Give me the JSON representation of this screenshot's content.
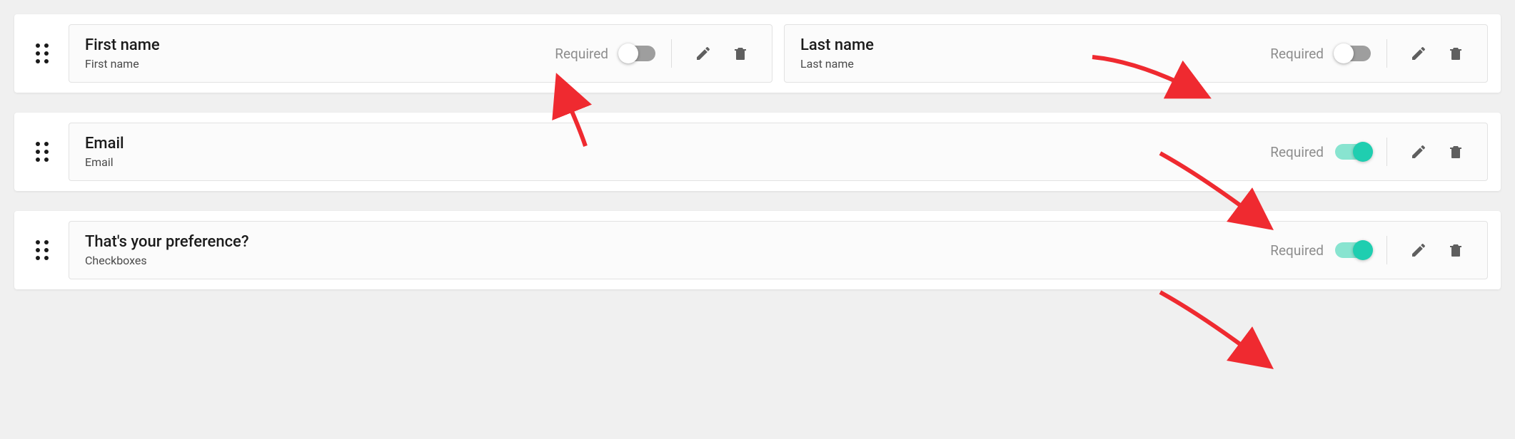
{
  "rows": [
    {
      "fields": [
        {
          "title": "First name",
          "subtitle": "First name",
          "required_label": "Required",
          "required_on": false
        },
        {
          "title": "Last name",
          "subtitle": "Last name",
          "required_label": "Required",
          "required_on": false
        }
      ]
    },
    {
      "fields": [
        {
          "title": "Email",
          "subtitle": "Email",
          "required_label": "Required",
          "required_on": true
        }
      ]
    },
    {
      "fields": [
        {
          "title": "That's your preference?",
          "subtitle": "Checkboxes",
          "required_label": "Required",
          "required_on": true
        }
      ]
    }
  ],
  "colors": {
    "toggle_off_track": "#9e9e9e",
    "toggle_on_track": "#88e4d0",
    "toggle_on_knob": "#1fceb0",
    "annotation_arrow": "#ef2a30"
  }
}
